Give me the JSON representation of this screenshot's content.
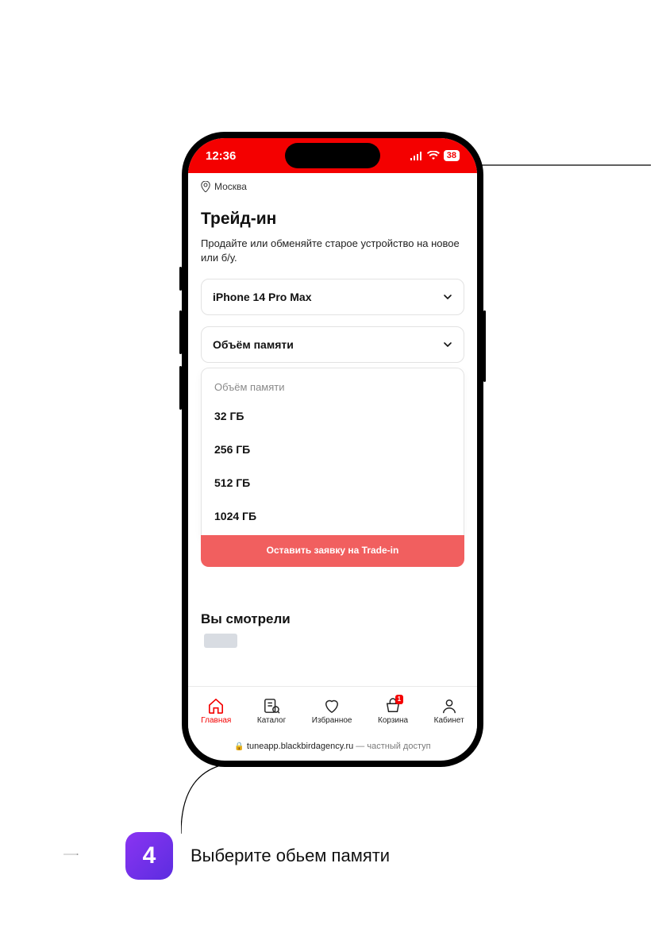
{
  "status": {
    "time": "12:36",
    "battery": "38"
  },
  "location": "Москва",
  "page": {
    "title": "Трейд-ин",
    "subtitle": "Продайте или обменяйте старое устройство на новое или б/у."
  },
  "device_select": {
    "value": "iPhone 14 Pro Max"
  },
  "storage_select": {
    "label": "Объём памяти",
    "panel_header": "Объём памяти",
    "options": [
      "32 ГБ",
      "256 ГБ",
      "512 ГБ",
      "1024 ГБ"
    ]
  },
  "cta_label": "Оставить заявку на Trade-in",
  "recent_title": "Вы смотрели",
  "nav": {
    "home": "Главная",
    "catalog": "Каталог",
    "fav": "Избранное",
    "cart": "Корзина",
    "cart_badge": "1",
    "account": "Кабинет"
  },
  "url": {
    "host": "tuneapp.blackbirdagency.ru",
    "suffix": " — частный доступ"
  },
  "step": {
    "number": "4",
    "text": "Выберите обьем памяти"
  }
}
